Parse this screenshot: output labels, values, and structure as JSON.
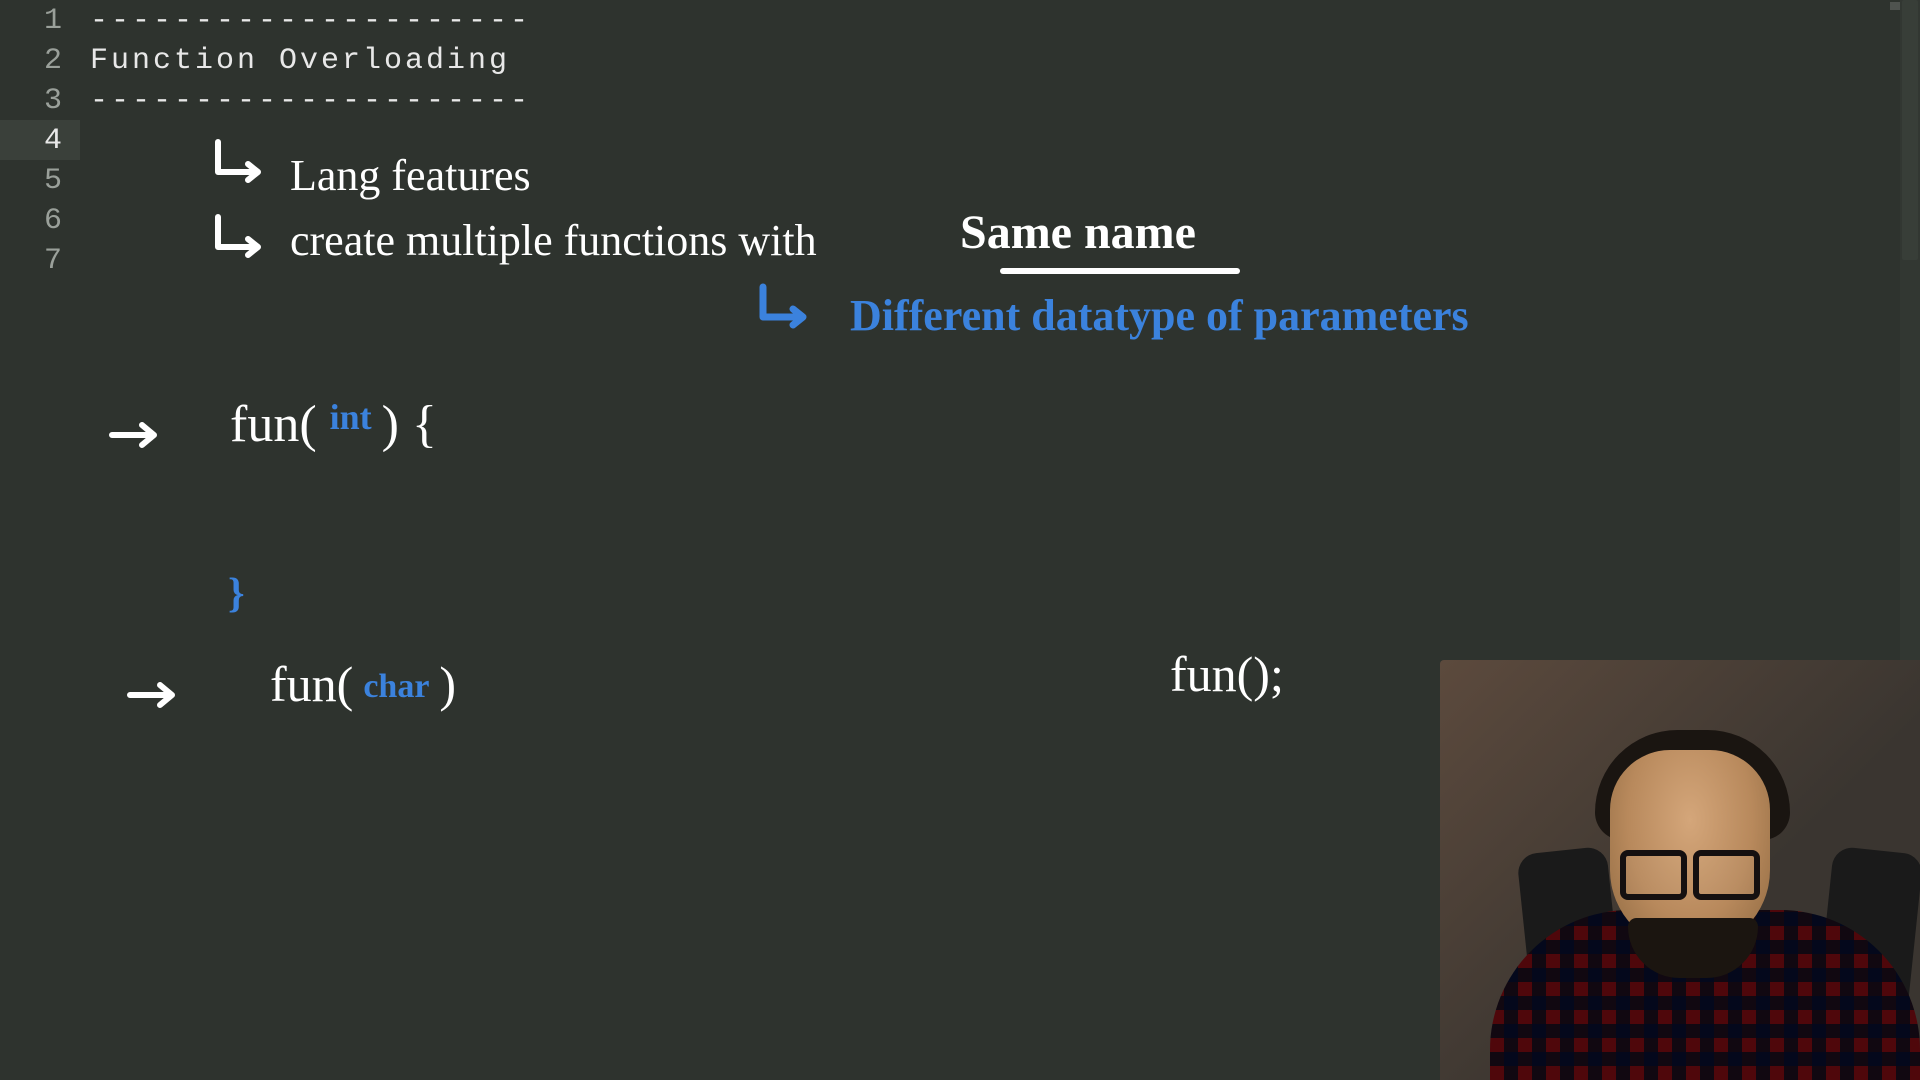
{
  "gutter": {
    "line_height": 40,
    "lines": [
      "1",
      "2",
      "3",
      "4",
      "5",
      "6",
      "7"
    ],
    "active_line_index": 3
  },
  "code": {
    "line1": "---------------------",
    "line2": "Function Overloading",
    "line3": "---------------------"
  },
  "notes": {
    "bullet1": "Lang features",
    "bullet2_a": "create  multiple  functions  with ",
    "bullet2_b": "Same  name",
    "sub_blue": "Different  datatype   of   parameters",
    "ex1_pre": "fun( ",
    "ex1_type": "int",
    "ex1_post": " ) {",
    "closebrace": "}",
    "ex2_pre": "fun(",
    "ex2_type": "char",
    "ex2_post": ")",
    "call": "fun();"
  },
  "colors": {
    "blue": "#3b82dd",
    "white": "#ffffff",
    "bg": "#2e332e"
  }
}
